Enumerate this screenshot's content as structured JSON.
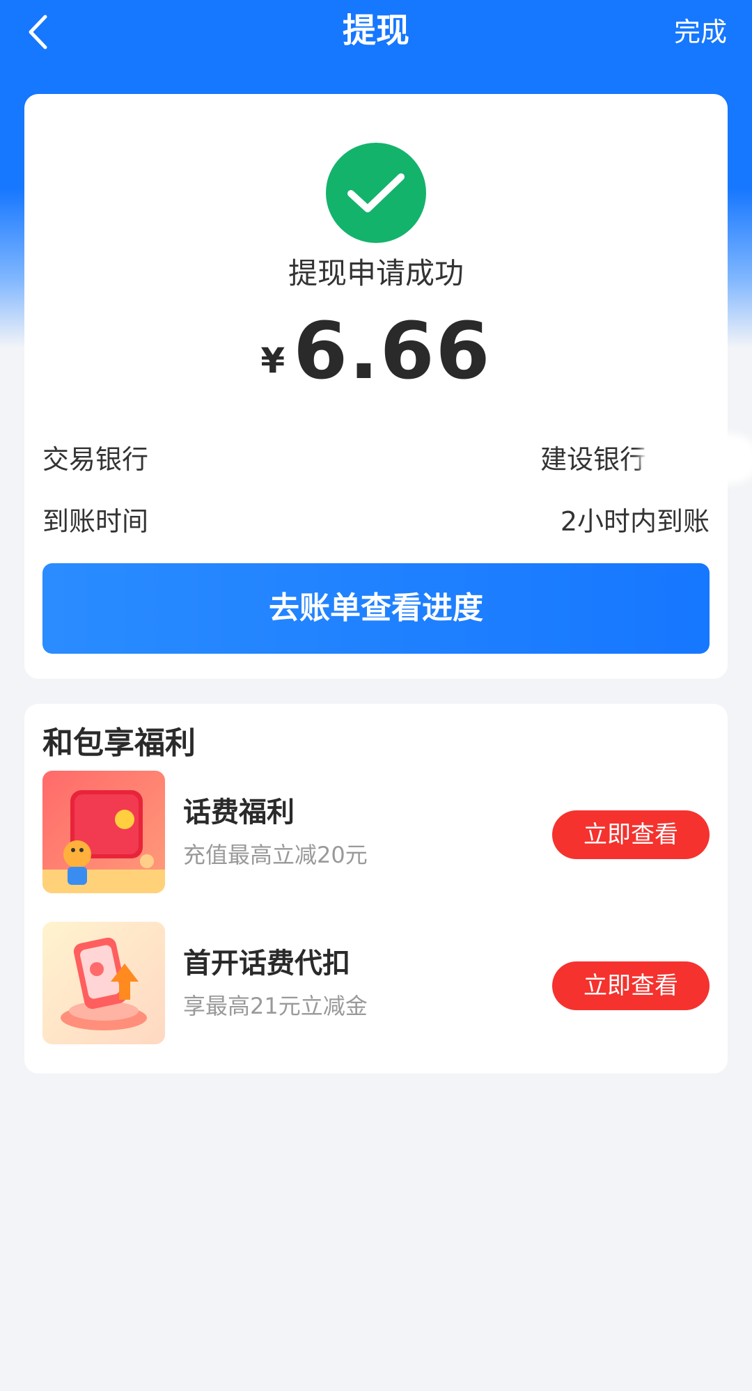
{
  "nav": {
    "title": "提现",
    "done_label": "完成"
  },
  "result": {
    "status": "提现申请成功",
    "currency": "¥",
    "amount": "6.66"
  },
  "details": [
    {
      "label": "交易银行",
      "value": "建设银行(尾号"
    },
    {
      "label": "到账时间",
      "value": "2小时内到账"
    }
  ],
  "progress_button": "去账单查看进度",
  "benefits": {
    "title": "和包享福利",
    "items": [
      {
        "name": "话费福利",
        "desc": "充值最高立减20元",
        "button": "立即查看"
      },
      {
        "name": "首开话费代扣",
        "desc": "享最高21元立减金",
        "button": "立即查看"
      }
    ]
  },
  "colors": {
    "brand_blue": "#1677ff",
    "success_green": "#14b36b",
    "action_red": "#f5322e"
  }
}
